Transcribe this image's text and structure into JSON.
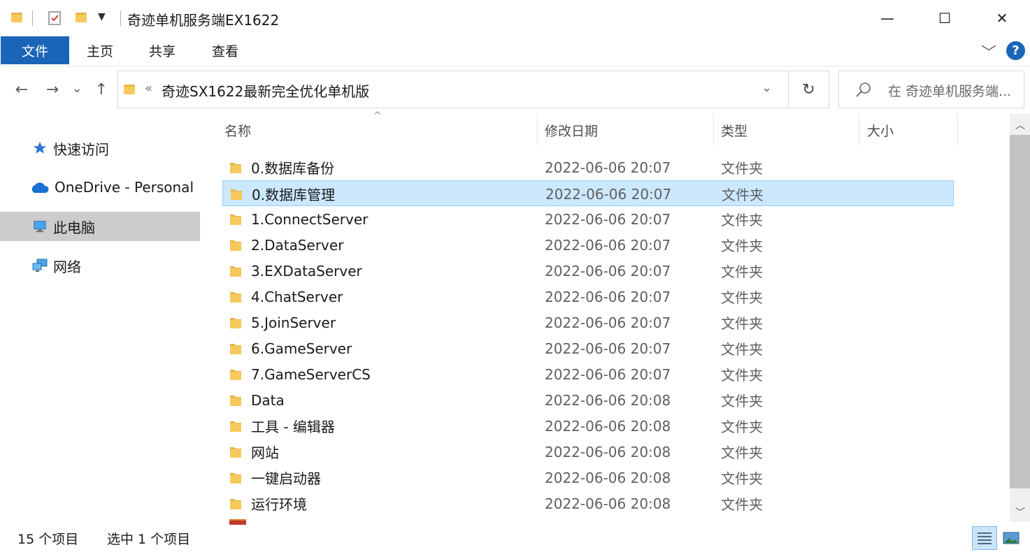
{
  "window": {
    "title": "奇迹单机服务端EX1622",
    "minimize_glyph": "—",
    "maximize_glyph": "☐",
    "close_glyph": "✕"
  },
  "ribbon": {
    "tabs": [
      "文件",
      "主页",
      "共享",
      "查看"
    ],
    "expand_glyph": "﹀",
    "help_glyph": "?"
  },
  "nav": {
    "back_glyph": "←",
    "forward_glyph": "→",
    "recent_glyph": "⌄",
    "up_glyph": "↑",
    "breadcrumb_overflow": "«",
    "path": "奇迹SX1622最新完全优化单机版",
    "refresh_glyph": "↻",
    "search_placeholder": "在 奇迹单机服务端..."
  },
  "sidebar": {
    "items": [
      {
        "label": "快速访问",
        "icon": "star-icon"
      },
      {
        "label": "OneDrive - Personal",
        "icon": "cloud-icon"
      },
      {
        "label": "此电脑",
        "icon": "computer-icon",
        "selected": true
      },
      {
        "label": "网络",
        "icon": "network-icon"
      }
    ]
  },
  "columns": {
    "name": "名称",
    "date": "修改日期",
    "type": "类型",
    "size": "大小",
    "sort_glyph": "^"
  },
  "files": [
    {
      "name": "0.数据库备份",
      "date": "2022-06-06 20:07",
      "type": "文件夹"
    },
    {
      "name": "0.数据库管理",
      "date": "2022-06-06 20:07",
      "type": "文件夹",
      "selected": true
    },
    {
      "name": "1.ConnectServer",
      "date": "2022-06-06 20:07",
      "type": "文件夹"
    },
    {
      "name": "2.DataServer",
      "date": "2022-06-06 20:07",
      "type": "文件夹"
    },
    {
      "name": "3.EXDataServer",
      "date": "2022-06-06 20:07",
      "type": "文件夹"
    },
    {
      "name": "4.ChatServer",
      "date": "2022-06-06 20:07",
      "type": "文件夹"
    },
    {
      "name": "5.JoinServer",
      "date": "2022-06-06 20:07",
      "type": "文件夹"
    },
    {
      "name": "6.GameServer",
      "date": "2022-06-06 20:07",
      "type": "文件夹"
    },
    {
      "name": "7.GameServerCS",
      "date": "2022-06-06 20:07",
      "type": "文件夹"
    },
    {
      "name": "Data",
      "date": "2022-06-06 20:08",
      "type": "文件夹"
    },
    {
      "name": "工具 - 编辑器",
      "date": "2022-06-06 20:08",
      "type": "文件夹"
    },
    {
      "name": "网站",
      "date": "2022-06-06 20:08",
      "type": "文件夹"
    },
    {
      "name": "一键启动器",
      "date": "2022-06-06 20:08",
      "type": "文件夹"
    },
    {
      "name": "运行环境",
      "date": "2022-06-06 20:08",
      "type": "文件夹"
    }
  ],
  "status": {
    "count": "15 个项目",
    "selection": "选中 1 个项目"
  },
  "colors": {
    "accent": "#1b65b8",
    "selection_bg": "#cce8ff",
    "selection_border": "#99d1ff",
    "folder": "#f7c95c"
  }
}
